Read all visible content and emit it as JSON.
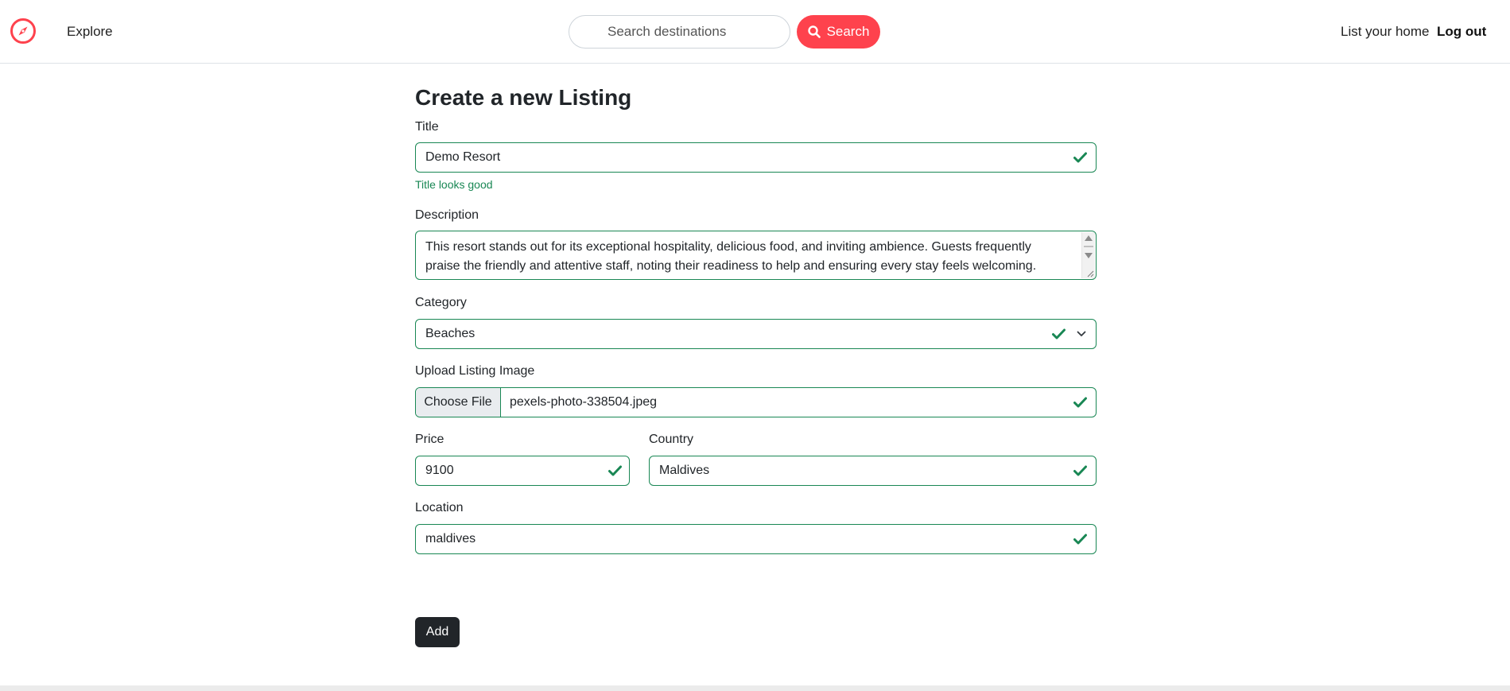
{
  "navbar": {
    "brand_icon": "compass-icon",
    "brand_color": "#fe424d",
    "explore_label": "Explore",
    "search_placeholder": "Search destinations",
    "search_button_label": "Search",
    "search_icon": "search-icon",
    "list_home_label": "List your home",
    "logout_label": "Log out"
  },
  "form": {
    "title": "Create a new Listing",
    "fields": {
      "title": {
        "label": "Title",
        "value": "Demo Resort",
        "valid_message": "Title looks good"
      },
      "description": {
        "label": "Description",
        "value": "This resort stands out for its exceptional hospitality, delicious food, and inviting ambience. Guests frequently praise the friendly and attentive staff, noting their readiness to help and ensuring every stay feels welcoming."
      },
      "category": {
        "label": "Category",
        "selected": "Beaches"
      },
      "image": {
        "label": "Upload Listing Image",
        "button_label": "Choose File",
        "file_name": "pexels-photo-338504.jpeg"
      },
      "price": {
        "label": "Price",
        "value": "9100"
      },
      "country": {
        "label": "Country",
        "value": "Maldives"
      },
      "location": {
        "label": "Location",
        "value": "maldives"
      }
    },
    "submit_label": "Add",
    "valid_color": "#198754"
  }
}
